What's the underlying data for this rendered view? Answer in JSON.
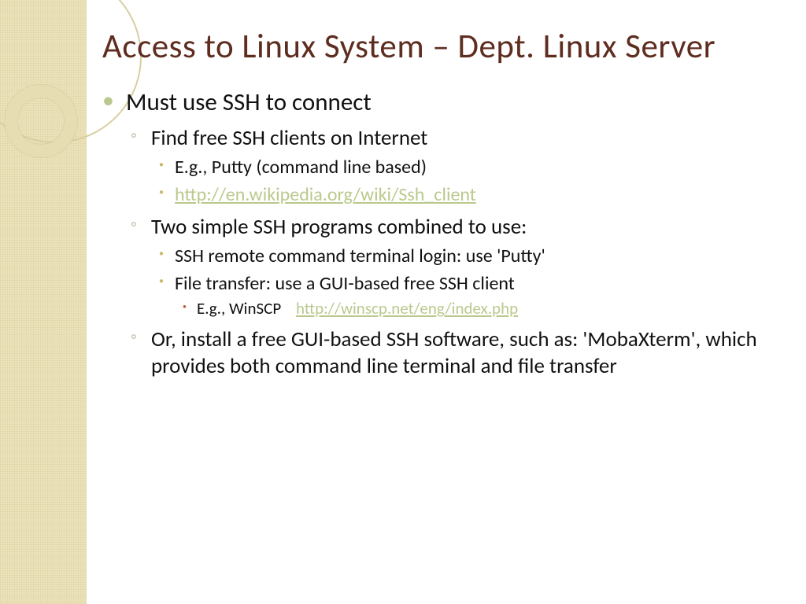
{
  "title": "Access to Linux System – Dept. Linux Server",
  "b1": "Must use SSH to connect",
  "b1s1": "Find free SSH clients on Internet",
  "b1s1d1": "E.g., Putty  (command line based)",
  "b1s1d2": "http://en.wikipedia.org/wiki/Ssh_client",
  "b1s2": "Two simple SSH programs combined to use:",
  "b1s2d1": "SSH remote command terminal login: use 'Putty'",
  "b1s2d2": "File transfer: use a GUI-based free SSH client",
  "b1s2d2e_pre": "E.g., WinSCP",
  "b1s2d2e_link": "http://winscp.net/eng/index.php",
  "b1s3": "Or, install a free GUI-based SSH software, such as: 'MobaXterm', which provides both command line terminal and file transfer"
}
